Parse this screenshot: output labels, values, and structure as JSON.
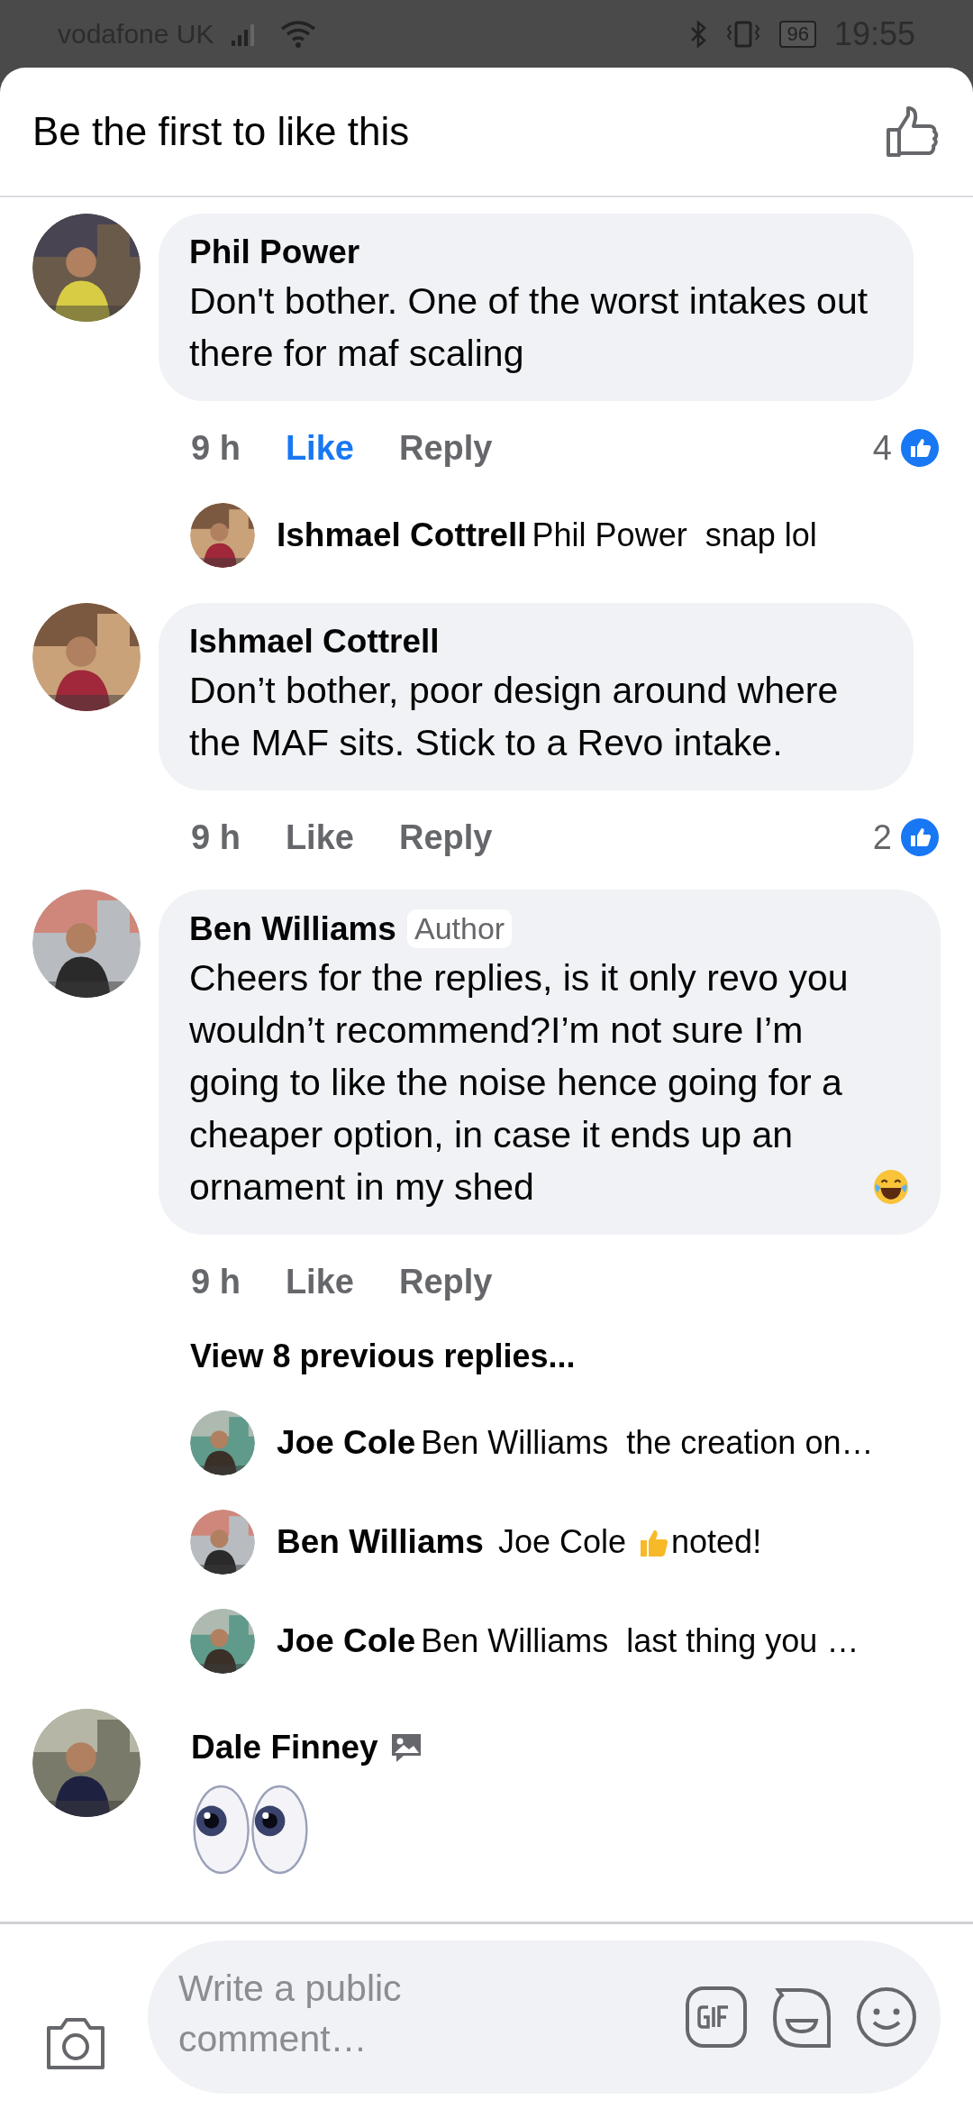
{
  "status_bar": {
    "carrier": "vodafone UK",
    "battery": "96",
    "time": "19:55"
  },
  "header": {
    "title": "Be the first to like this"
  },
  "comments": [
    {
      "kind": "text",
      "author": "Phil Power",
      "text": "Don't bother. One of the worst intakes out there for  maf scaling",
      "time": "9 h",
      "like_label": "Like",
      "liked": true,
      "reply_label": "Reply",
      "reactions": "4",
      "replies": [
        {
          "author": "Ishmael Cottrell",
          "text": "Phil Power  snap lol"
        }
      ]
    },
    {
      "kind": "text",
      "author": "Ishmael Cottrell",
      "text": "Don’t bother, poor design around where the MAF sits. Stick to a Revo intake.",
      "time": "9 h",
      "like_label": "Like",
      "liked": false,
      "reply_label": "Reply",
      "reactions": "2"
    },
    {
      "kind": "text",
      "author": "Ben Williams",
      "badge": "Author",
      "text": "Cheers for the replies, is it only revo you wouldn’t recommend?I’m not sure I’m going to like the noise hence going for a cheaper option, in case it ends up an ornament in my shed",
      "laugh_emoji": true,
      "time": "9 h",
      "like_label": "Like",
      "liked": false,
      "reply_label": "Reply",
      "view_more": "View 8 previous replies...",
      "replies": [
        {
          "author": "Joe Cole",
          "text": "Ben Williams  the creation on…"
        },
        {
          "author": "Ben Williams",
          "text": " Joe Cole ",
          "thumb_emoji": true,
          "after": "noted!"
        },
        {
          "author": "Joe Cole",
          "text": "Ben Williams  last thing you …"
        }
      ]
    },
    {
      "kind": "emoji",
      "author": "Dale Finney",
      "image_comment": true
    }
  ],
  "composer": {
    "placeholder": "Write a public comment…"
  }
}
